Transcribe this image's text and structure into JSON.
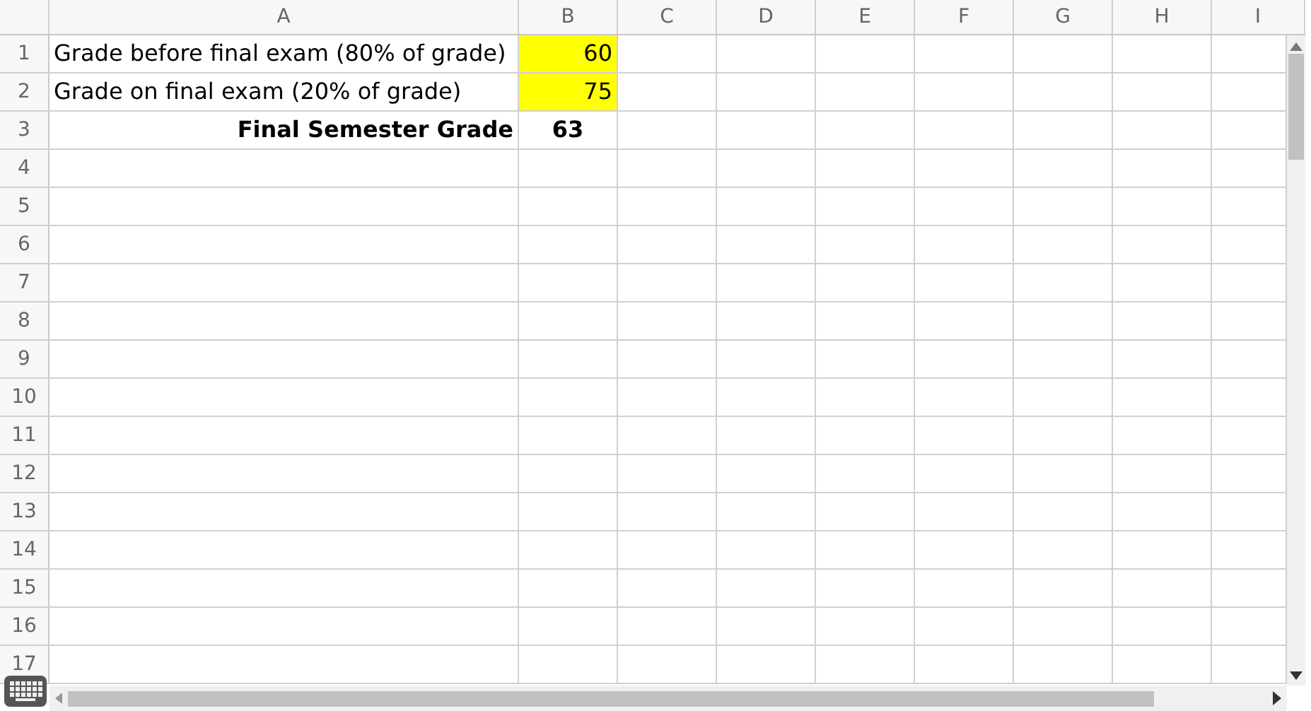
{
  "columns": [
    "A",
    "B",
    "C",
    "D",
    "E",
    "F",
    "G",
    "H",
    "I"
  ],
  "rows": [
    {
      "number": "1",
      "cells": [
        {
          "text": "Grade before final exam (80% of grade)",
          "kind": "text",
          "highlighted": false
        },
        {
          "text": "60",
          "kind": "number",
          "highlighted": true
        }
      ]
    },
    {
      "number": "2",
      "cells": [
        {
          "text": "Grade on final exam (20% of grade)",
          "kind": "text",
          "highlighted": false
        },
        {
          "text": "75",
          "kind": "number",
          "highlighted": true
        }
      ]
    },
    {
      "number": "3",
      "cells": [
        {
          "text": "Final Semester Grade",
          "kind": "heading",
          "highlighted": false
        },
        {
          "text": "63",
          "kind": "total",
          "highlighted": false
        }
      ]
    },
    {
      "number": "4",
      "cells": []
    },
    {
      "number": "5",
      "cells": []
    },
    {
      "number": "6",
      "cells": []
    },
    {
      "number": "7",
      "cells": []
    },
    {
      "number": "8",
      "cells": []
    },
    {
      "number": "9",
      "cells": []
    },
    {
      "number": "10",
      "cells": []
    },
    {
      "number": "11",
      "cells": []
    },
    {
      "number": "12",
      "cells": []
    },
    {
      "number": "13",
      "cells": []
    },
    {
      "number": "14",
      "cells": []
    },
    {
      "number": "15",
      "cells": []
    },
    {
      "number": "16",
      "cells": []
    },
    {
      "number": "17",
      "cells": []
    }
  ]
}
